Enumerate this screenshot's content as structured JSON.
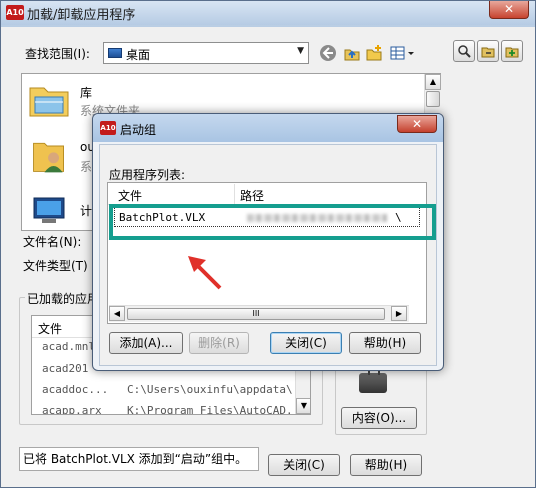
{
  "window": {
    "title": "加载/卸载应用程序",
    "app_icon_text": "A10",
    "close_glyph": "✕"
  },
  "look_in": {
    "label": "查找范围(I):",
    "value": "桌面"
  },
  "toolbar": {
    "icons": [
      "back-icon",
      "up-folder-icon",
      "new-folder-icon",
      "views-icon",
      "find-icon",
      "unload-icon",
      "load-icon"
    ]
  },
  "file_list": {
    "items": [
      {
        "name": "库",
        "sub": "系统文件夹"
      },
      {
        "name": "ou",
        "sub": "系"
      },
      {
        "name": "计",
        "sub": ""
      }
    ]
  },
  "fields": {
    "filename_label": "文件名(N):",
    "filetype_label": "文件类型(T)"
  },
  "loaded": {
    "group_label": "已加载的应用",
    "column": "文件",
    "rows": [
      {
        "file": "acad.mnl",
        "path": ""
      },
      {
        "file": "acad201",
        "path": ""
      },
      {
        "file": "acaddoc...",
        "path": "C:\\Users\\ouxinfu\\appdata\\..."
      },
      {
        "file": "acapp.arx",
        "path": "K:\\Program Files\\AutoCAD..."
      }
    ]
  },
  "contents_button": "内容(O)...",
  "status_text": "已将 BatchPlot.VLX 添加到“启动”组中。",
  "main_buttons": {
    "close": "关闭(C)",
    "help": "帮助(H)"
  },
  "startup_dialog": {
    "title": "启动组",
    "app_icon_text": "A10",
    "close_glyph": "✕",
    "list_label": "应用程序列表:",
    "columns": {
      "file": "文件",
      "path": "路径"
    },
    "rows": [
      {
        "file": "BatchPlot.VLX",
        "path_end": "\\"
      }
    ],
    "buttons": {
      "add": "添加(A)...",
      "remove": "删除(R)",
      "close": "关闭(C)",
      "help": "帮助(H)"
    },
    "scroll_glyph": "III"
  },
  "colors": {
    "highlight": "#159e8f",
    "arrow": "#e0302a",
    "title_gradient_top": "#d8e5f3"
  }
}
